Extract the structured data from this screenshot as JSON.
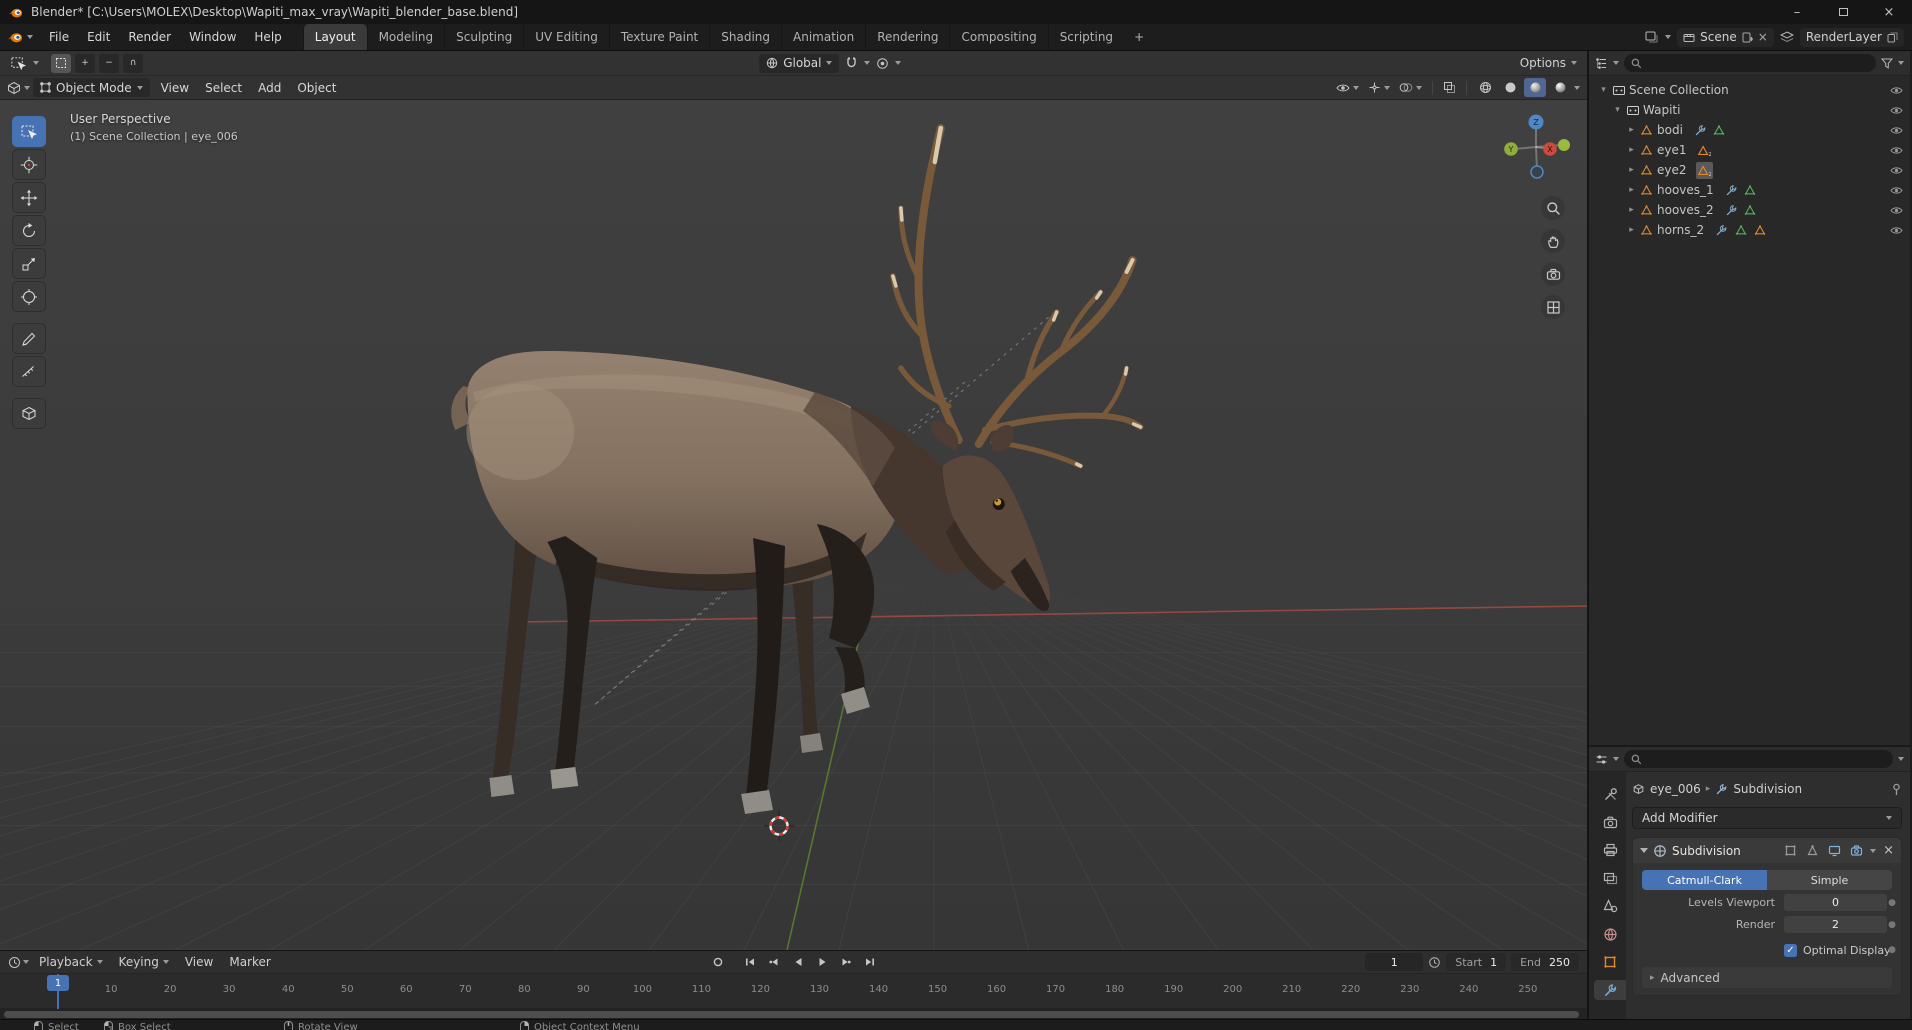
{
  "titlebar": {
    "title": "Blender* [C:\\Users\\MOLEX\\Desktop\\Wapiti_max_vray\\Wapiti_blender_base.blend]"
  },
  "topbar": {
    "menus": [
      "File",
      "Edit",
      "Render",
      "Window",
      "Help"
    ],
    "workspaces": [
      "Layout",
      "Modeling",
      "Sculpting",
      "UV Editing",
      "Texture Paint",
      "Shading",
      "Animation",
      "Rendering",
      "Compositing",
      "Scripting"
    ],
    "active_workspace": "Layout",
    "new_workspace_label": "+",
    "scene": {
      "value": "Scene"
    },
    "view_layer": {
      "value": "RenderLayer"
    }
  },
  "tool_header": {
    "orientation_value": "Global",
    "options_label": "Options"
  },
  "viewport_header": {
    "mode_value": "Object Mode",
    "menus": [
      "View",
      "Select",
      "Add",
      "Object"
    ]
  },
  "viewport": {
    "perspective_label": "User Perspective",
    "context_label": "(1) Scene Collection | eye_006",
    "gizmo": {
      "x": "X",
      "y": "Y",
      "z": "Z"
    }
  },
  "outliner": {
    "root_label": "Scene Collection",
    "collection_label": "Wapiti",
    "items": [
      {
        "name": "bodi",
        "badges": [
          "wrench",
          "mesh-data"
        ]
      },
      {
        "name": "eye1",
        "badges": [
          "mesh-orange-2"
        ]
      },
      {
        "name": "eye2",
        "badges": [
          "mesh-orange-2-active"
        ]
      },
      {
        "name": "hooves_1",
        "badges": [
          "wrench",
          "mesh-data"
        ]
      },
      {
        "name": "hooves_2",
        "badges": [
          "wrench",
          "mesh-data"
        ]
      },
      {
        "name": "horns_2",
        "badges": [
          "wrench",
          "mesh-data",
          "mesh-orange"
        ]
      }
    ]
  },
  "properties": {
    "breadcrumb": {
      "object": "eye_006",
      "modifier": "Subdivision"
    },
    "add_modifier_label": "Add Modifier",
    "modifier": {
      "name": "Subdivision",
      "subdivision_types": [
        "Catmull-Clark",
        "Simple"
      ],
      "active_type": "Catmull-Clark",
      "rows": {
        "levels_viewport": {
          "label": "Levels Viewport",
          "value": "0"
        },
        "render": {
          "label": "Render",
          "value": "2"
        }
      },
      "optimal_display_label": "Optimal Display",
      "optimal_display_checked": true,
      "advanced_label": "Advanced"
    }
  },
  "timeline": {
    "menus": [
      {
        "label": "Playback",
        "chevron": true
      },
      {
        "label": "Keying",
        "chevron": true
      },
      {
        "label": "View",
        "chevron": false
      },
      {
        "label": "Marker",
        "chevron": false
      }
    ],
    "current_frame": "1",
    "playhead_label": "1",
    "start": {
      "label": "Start",
      "value": "1"
    },
    "end": {
      "label": "End",
      "value": "250"
    },
    "ticks": [
      10,
      20,
      30,
      40,
      50,
      60,
      70,
      80,
      90,
      100,
      110,
      120,
      130,
      140,
      150,
      160,
      170,
      180,
      190,
      200,
      210,
      220,
      230,
      240,
      250
    ]
  },
  "statusbar": {
    "items": [
      "Select",
      "Box Select",
      "Rotate View",
      "Object Context Menu"
    ]
  },
  "colors": {
    "accent": "#4772b3",
    "object_orange": "#e0882c",
    "axis_x": "#9f4a40",
    "axis_y": "#5c7d2e",
    "axis_z": "#4f87c7"
  }
}
